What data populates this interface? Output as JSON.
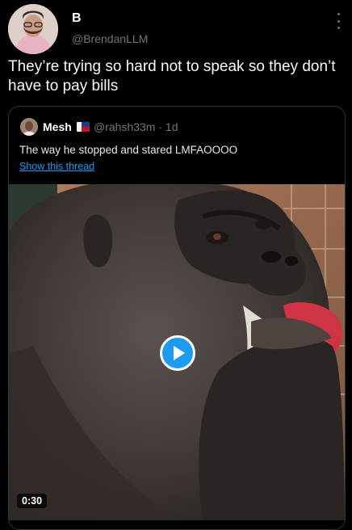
{
  "tweet": {
    "author_name": "B",
    "author_handle": "@BrendanLLM",
    "text": "They’re trying so hard not to speak so they don’t have to pay bills",
    "avatar_icon": "avatar-photo-icon",
    "more_icon": "more-options-icon"
  },
  "quote": {
    "author_name": "Mesh",
    "author_handle": "@rahsh33m · 1d",
    "flag_icon": "flag-icon",
    "text": "The way he stopped and stared LMFAOOOO",
    "show_thread_label": "Show this thread",
    "video": {
      "duration": "0:30",
      "play_icon": "play-icon"
    }
  },
  "colors": {
    "background": "#000000",
    "text": "#e7e9ea",
    "muted": "#71767b",
    "accent": "#1d9bf0",
    "border": "#2f3336"
  }
}
